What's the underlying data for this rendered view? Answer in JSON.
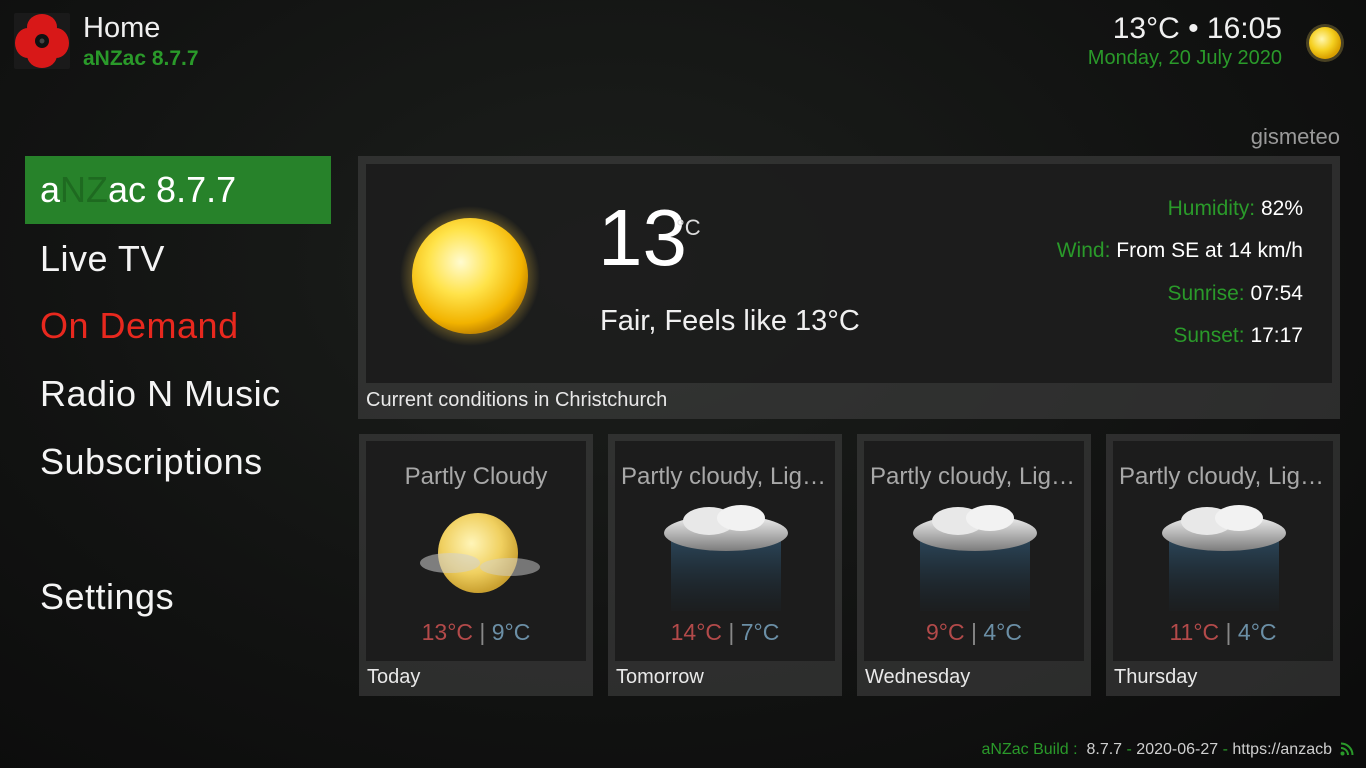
{
  "header": {
    "title": "Home",
    "subtitle": "aNZac 8.7.7",
    "clock": "13°C • 16:05",
    "date": "Monday, 20 July 2020"
  },
  "menu": {
    "selected": {
      "prefix": "a",
      "nz": "NZ",
      "suffix": "ac 8.7.7"
    },
    "items": [
      {
        "label": "Live TV"
      },
      {
        "label": "On Demand"
      },
      {
        "label": "Radio N Music"
      },
      {
        "label": "Subscriptions"
      },
      {
        "label": "Settings"
      }
    ]
  },
  "weather": {
    "provider": "gismeteo",
    "current": {
      "temperature": "13",
      "unit": "°C",
      "condition": "Fair, Feels like 13°C",
      "humidity_label": "Humidity:",
      "humidity": "82%",
      "wind_label": "Wind:",
      "wind": "From SE at 14 km/h",
      "sunrise_label": "Sunrise:",
      "sunrise": "07:54",
      "sunset_label": "Sunset:",
      "sunset": "17:17",
      "caption": "Current conditions in Christchurch"
    },
    "forecast": [
      {
        "desc": "Partly Cloudy",
        "high": "13°C",
        "sep": "|",
        "low": "9°C",
        "day": "Today",
        "icon": "partly-cloudy-icon"
      },
      {
        "desc": "Partly cloudy, Light rain",
        "high": "14°C",
        "sep": "|",
        "low": "7°C",
        "day": "Tomorrow",
        "icon": "rain-cloud-icon"
      },
      {
        "desc": "Partly cloudy, Light rain",
        "high": "9°C",
        "sep": "|",
        "low": "4°C",
        "day": "Wednesday",
        "icon": "rain-cloud-icon"
      },
      {
        "desc": "Partly cloudy, Light rain",
        "high": "11°C",
        "sep": "|",
        "low": "4°C",
        "day": "Thursday",
        "icon": "rain-cloud-icon"
      }
    ]
  },
  "footer": {
    "label": "aNZac Build :",
    "version": "8.7.7",
    "sep1": "-",
    "date": "2020-06-27",
    "sep2": "-",
    "url": "https://anzacb"
  },
  "colors": {
    "accent": "#27822a",
    "label_green": "#2a9a2a",
    "on_demand_red": "#e8281e",
    "temp_high": "#b34a4a",
    "temp_low": "#6b8fa6"
  }
}
